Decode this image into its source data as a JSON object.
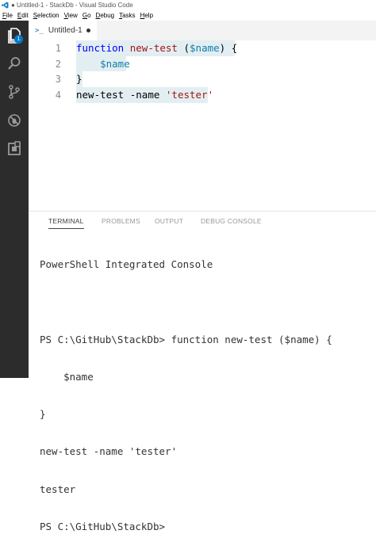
{
  "window": {
    "title": "● Untitled-1 - StackDb - Visual Studio Code"
  },
  "menu": [
    {
      "label": "File",
      "u": "F",
      "rest": "ile"
    },
    {
      "label": "Edit",
      "u": "E",
      "rest": "dit"
    },
    {
      "label": "Selection",
      "u": "S",
      "rest": "election"
    },
    {
      "label": "View",
      "u": "V",
      "rest": "iew"
    },
    {
      "label": "Go",
      "u": "G",
      "rest": "o"
    },
    {
      "label": "Debug",
      "u": "D",
      "rest": "ebug"
    },
    {
      "label": "Tasks",
      "u": "T",
      "rest": "asks"
    },
    {
      "label": "Help",
      "u": "H",
      "rest": "elp"
    }
  ],
  "activitybar": {
    "explorer_badge": "1",
    "icons": [
      "files-icon",
      "search-icon",
      "source-control-icon",
      "debug-icon",
      "extensions-icon"
    ]
  },
  "editor": {
    "tab_icon": ">_",
    "tab_label": "Untitled-1",
    "line_numbers": [
      "1",
      "2",
      "3",
      "4"
    ],
    "lines": [
      {
        "t1": "function",
        "t2": " ",
        "t3": "new-test",
        "t4": " (",
        "t5": "$name",
        "t6": ") {"
      },
      {
        "t1": "    ",
        "t2": "$name"
      },
      {
        "t1": "}"
      },
      {
        "t1": "new-test",
        "t2": " -name ",
        "t3": "'tester'"
      }
    ]
  },
  "panel": {
    "tabs": [
      "TERMINAL",
      "PROBLEMS",
      "OUTPUT",
      "DEBUG CONSOLE"
    ],
    "active_tab": "TERMINAL",
    "terminal_lines": [
      "PowerShell Integrated Console",
      "",
      "PS C:\\GitHub\\StackDb> function new-test ($name) {",
      "    $name",
      "}",
      "new-test -name 'tester'",
      "tester",
      "PS C:\\GitHub\\StackDb>"
    ]
  },
  "colors": {
    "activitybar": "#2c2c2c",
    "badge": "#007acc",
    "keyword": "#0000ff",
    "string": "#a31515",
    "variable": "#0f7fa8",
    "selection": "#e3eef2"
  }
}
